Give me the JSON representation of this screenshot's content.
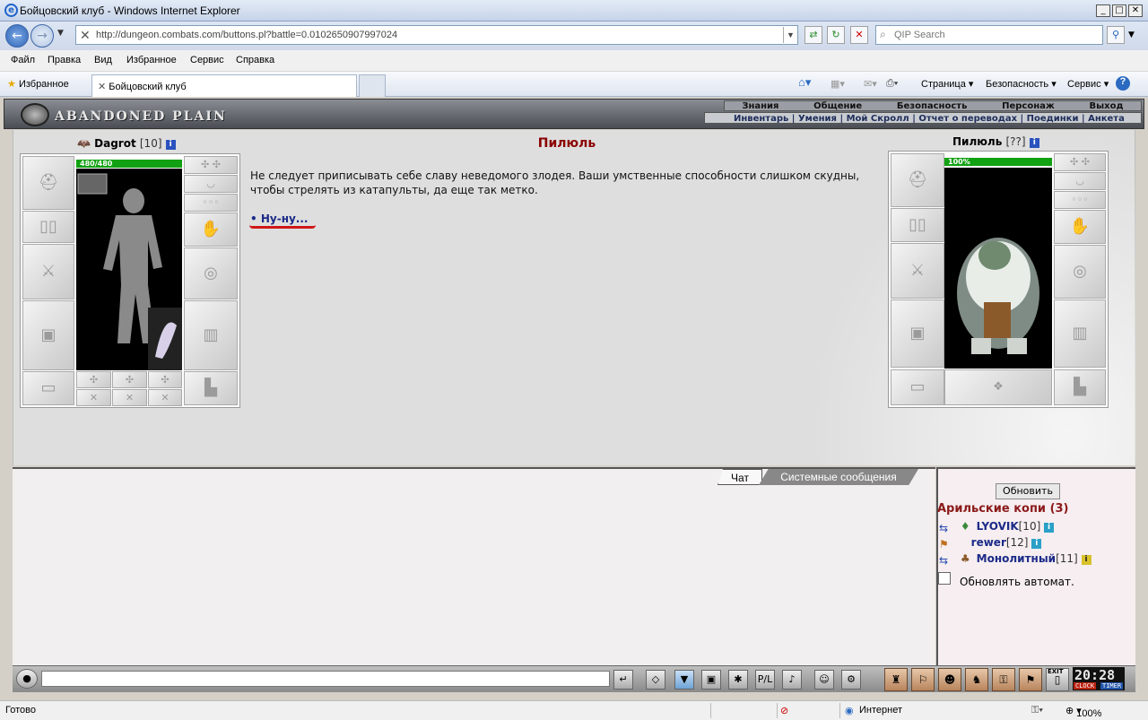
{
  "window": {
    "title": "Бойцовский клуб - Windows Internet Explorer"
  },
  "address": {
    "url": "http://dungeon.combats.com/buttons.pl?battle=0.0102650907997024",
    "search_placeholder": "QIP Search"
  },
  "menu": [
    "Файл",
    "Правка",
    "Вид",
    "Избранное",
    "Сервис",
    "Справка"
  ],
  "tabs": {
    "favorites": "Избранное",
    "active_tab": "Бойцовский клуб"
  },
  "commandbar": {
    "page": "Страница",
    "safety": "Безопасность",
    "tools": "Сервис",
    "zoom_icon": "home-icon"
  },
  "game": {
    "logo": "ABANDONED PLAIN",
    "top_nav": [
      "Знания",
      "Общение",
      "Безопасность",
      "Персонаж",
      "Выход"
    ],
    "sub_nav": [
      "Инвентарь",
      "Умения",
      "Мой Скролл",
      "Отчет о переводах",
      "Поединки",
      "Анкета"
    ]
  },
  "player": {
    "name": "Dagrot",
    "level": "[10]",
    "hp": "480/480",
    "hp_fraction": 1.0
  },
  "enemy": {
    "name": "Пилюль",
    "level": "[??]",
    "hp": "100%",
    "hp_fraction": 1.0
  },
  "dialog": {
    "title": "Пилюль",
    "text": "Не следует приписывать себе славу неведомого злодея. Ваши умственные способности слишком скудны, чтобы стрелять из катапульты, да еще так метко.",
    "answer": "• Ну-ну..."
  },
  "chat": {
    "tab_chat": "Чат",
    "tab_system": "Системные сообщения"
  },
  "sidebar": {
    "refresh": "Обновить",
    "room": "Арильские копи (3)",
    "players": [
      {
        "name": "LYOVIK",
        "level": "[10]"
      },
      {
        "name": "rewer",
        "level": "[12]"
      },
      {
        "name": "Монолитный",
        "level": "[11]"
      }
    ],
    "auto": "Обновлять автомат."
  },
  "clock": {
    "time": "20:28",
    "clock_label": "CLOCK",
    "timer_label": "TIMER",
    "exit": "EXIT"
  },
  "status": {
    "text": "Готово",
    "zone": "Интернет",
    "zoom": "100%"
  }
}
